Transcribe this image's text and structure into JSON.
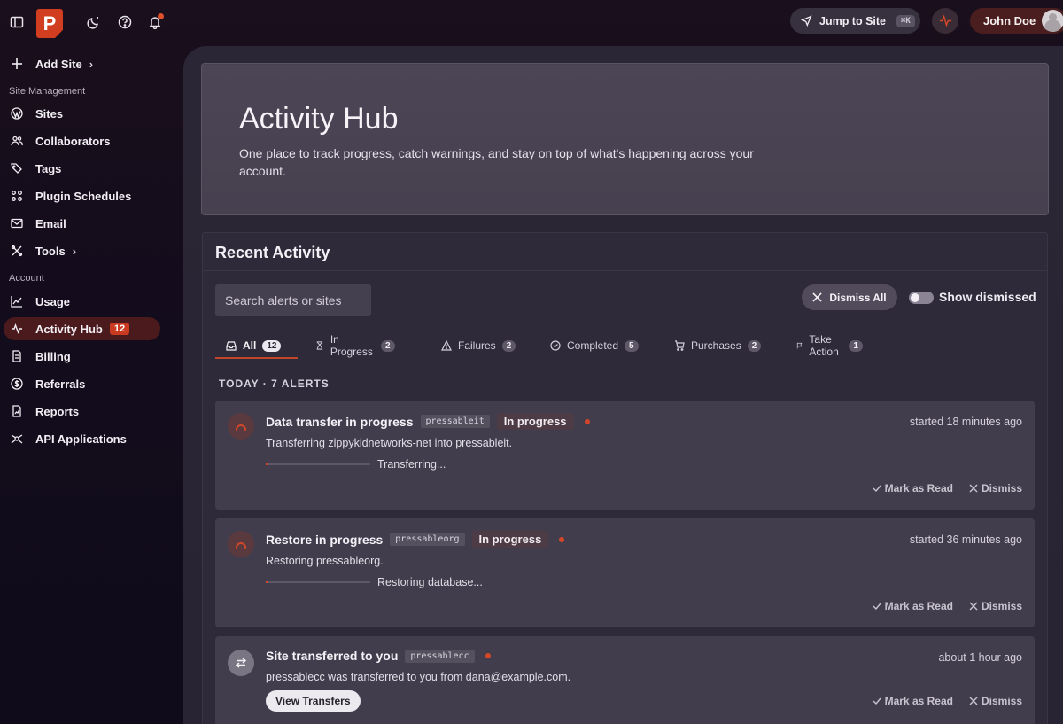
{
  "topbar": {
    "logo_letter": "P",
    "jump_label": "Jump to Site",
    "jump_shortcut": "⌘K",
    "user_name": "John Doe"
  },
  "sidebar": {
    "add_site": "Add Site",
    "section_site_management": "Site Management",
    "site_items": [
      {
        "label": "Sites",
        "icon": "wordpress-icon"
      },
      {
        "label": "Collaborators",
        "icon": "users-icon"
      },
      {
        "label": "Tags",
        "icon": "tags-icon"
      },
      {
        "label": "Plugin Schedules",
        "icon": "grid-icon"
      },
      {
        "label": "Email",
        "icon": "mail-icon"
      },
      {
        "label": "Tools",
        "icon": "tools-icon"
      }
    ],
    "section_account": "Account",
    "account_items": [
      {
        "label": "Usage",
        "icon": "chart-icon"
      },
      {
        "label": "Activity Hub",
        "icon": "pulse-icon",
        "badge": "12"
      },
      {
        "label": "Billing",
        "icon": "document-icon"
      },
      {
        "label": "Referrals",
        "icon": "dollar-icon"
      },
      {
        "label": "Reports",
        "icon": "report-icon"
      },
      {
        "label": "API Applications",
        "icon": "api-icon"
      }
    ]
  },
  "hero": {
    "title": "Activity Hub",
    "subtitle": "One place to track progress, catch warnings, and stay on top of what's happening across your account."
  },
  "activity": {
    "title": "Recent Activity",
    "search_placeholder": "Search alerts or sites",
    "dismiss_all": "Dismiss All",
    "show_dismissed": "Show dismissed",
    "tabs": [
      {
        "label": "All",
        "count": "12"
      },
      {
        "label": "In Progress",
        "count": "2"
      },
      {
        "label": "Failures",
        "count": "2"
      },
      {
        "label": "Completed",
        "count": "5"
      },
      {
        "label": "Purchases",
        "count": "2"
      },
      {
        "label": "Take Action",
        "count": "1"
      }
    ],
    "today_label": "TODAY · 7 ALERTS",
    "mark_read": "Mark as Read",
    "dismiss": "Dismiss",
    "cards": [
      {
        "title": "Data transfer in progress",
        "site": "pressableit",
        "status": "In progress",
        "time": "started 18 minutes ago",
        "desc": "Transferring zippykidnetworks-net into pressableit.",
        "progress_label": "Transferring...",
        "progress": 0.02
      },
      {
        "title": "Restore in progress",
        "site": "pressableorg",
        "status": "In progress",
        "time": "started 36 minutes ago",
        "desc": "Restoring pressableorg.",
        "progress_label": "Restoring database...",
        "progress": 0.02
      },
      {
        "title": "Site transferred to you",
        "site": "pressablecc",
        "time": "about 1 hour ago",
        "desc": "pressablecc was transferred to you from dana@example.com.",
        "button": "View Transfers"
      }
    ]
  },
  "colors": {
    "accent": "#d2472a",
    "active_nav": "#4a1a1d",
    "panel": "#2e2a39"
  }
}
